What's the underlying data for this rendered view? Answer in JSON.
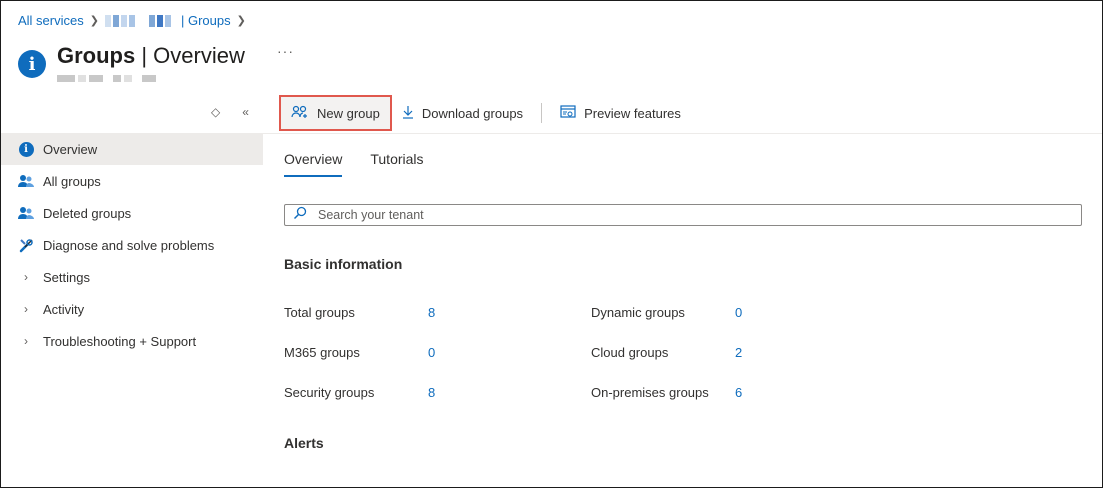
{
  "breadcrumb": {
    "home": "All services",
    "current": "| Groups"
  },
  "header": {
    "title_bold": "Groups",
    "title_rest": " | Overview",
    "more": "···"
  },
  "sidebar": {
    "items": [
      {
        "label": "Overview",
        "icon": "info-icon",
        "active": true
      },
      {
        "label": "All groups",
        "icon": "people-icon"
      },
      {
        "label": "Deleted groups",
        "icon": "people-icon"
      },
      {
        "label": "Diagnose and solve problems",
        "icon": "wrench-icon"
      },
      {
        "label": "Settings",
        "icon": "chevron-right-icon"
      },
      {
        "label": "Activity",
        "icon": "chevron-right-icon"
      },
      {
        "label": "Troubleshooting + Support",
        "icon": "chevron-right-icon"
      }
    ]
  },
  "toolbar": {
    "new_group": "New group",
    "download_groups": "Download groups",
    "preview_features": "Preview features"
  },
  "tabs": [
    "Overview",
    "Tutorials"
  ],
  "search": {
    "placeholder": "Search your tenant",
    "value": ""
  },
  "basic_info": {
    "title": "Basic information",
    "stats": [
      {
        "label": "Total groups",
        "value": "8"
      },
      {
        "label": "Dynamic groups",
        "value": "0"
      },
      {
        "label": "M365 groups",
        "value": "0"
      },
      {
        "label": "Cloud groups",
        "value": "2"
      },
      {
        "label": "Security groups",
        "value": "8"
      },
      {
        "label": "On-premises groups",
        "value": "6"
      }
    ]
  },
  "alerts": {
    "title": "Alerts"
  },
  "colors": {
    "accent": "#0f6cbd",
    "highlight_border": "#e0584d",
    "active_bg": "#edebe9"
  }
}
